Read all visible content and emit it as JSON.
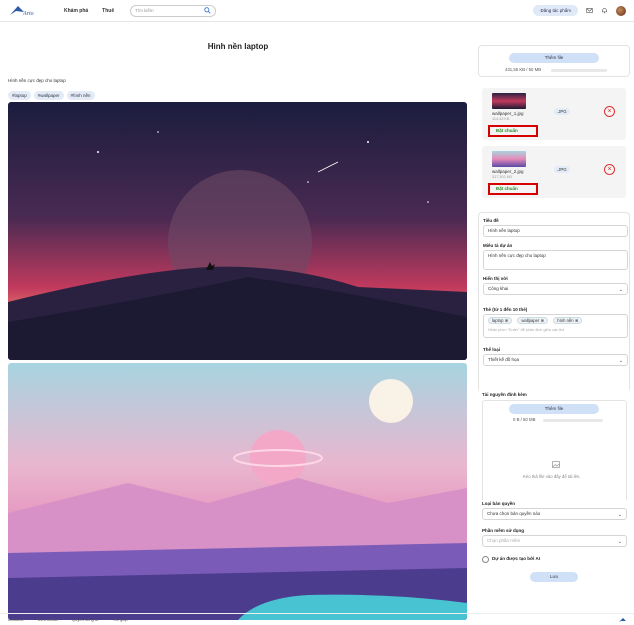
{
  "nav": {
    "items": [
      "Khám phá",
      "Thuê"
    ],
    "search_placeholder": "Tìm kiếm",
    "partner_label": "Đăng tác phẩm"
  },
  "project": {
    "title": "Hình nền laptop",
    "description": "Hình nền cực đẹp cho laptop",
    "tags": [
      "#laptop",
      "#wallpaper",
      "#hình nền"
    ]
  },
  "upload": {
    "add_label": "Thêm file",
    "usage": "431,55 KB / 50 MB",
    "usage_fraction": 0.009
  },
  "files": [
    {
      "name": "wallpaper_1.jpg",
      "size": "114,43 KB",
      "ext": ".JPG",
      "cover_label": "Đặt chuẩn"
    },
    {
      "name": "wallpaper_2.jpg",
      "size": "317,302 KB",
      "ext": ".JPG",
      "cover_label": "Đặt chuẩn"
    }
  ],
  "form": {
    "title_label": "Tiêu đề",
    "title_value": "Hình nền laptop",
    "desc_label": "Miêu tả dự án",
    "desc_value": "Hình nền cực đẹp cho laptop",
    "visibility_label": "Hiển thị với",
    "visibility_value": "Công khai",
    "tags_label": "Thẻ (từ 1 đến 10 thẻ)",
    "tags": [
      "laptop",
      "wallpaper",
      "hình nền"
    ],
    "tags_hint": "Nhấn phím \"Enter\" để phân định giữa các thẻ",
    "category_label": "Thể loại",
    "category_value": "Thiết kế đồ họa",
    "attach_label": "Tài nguyên đính kèm",
    "attach_add": "Thêm file",
    "attach_usage": "0 B / 50 MB",
    "attach_drop": "Kéo thả file vào đây để tải lên.",
    "license_label": "Loại bản quyền",
    "license_value": "Chưa chọn bản quyền nào",
    "software_label": "Phần mềm sử dụng",
    "software_placeholder": "Chọn phần mềm",
    "ai_label": "Dự án được tạo bởi AI",
    "save_label": "Lưu"
  },
  "footer": {
    "links": [
      "Artworke",
      "Điều khoản",
      "Quyền riêng tư",
      "Trợ giúp"
    ]
  },
  "colors": {
    "accent": "#cfe0f7",
    "highlight": "#d60000",
    "cover_text": "#2a8a2a"
  }
}
